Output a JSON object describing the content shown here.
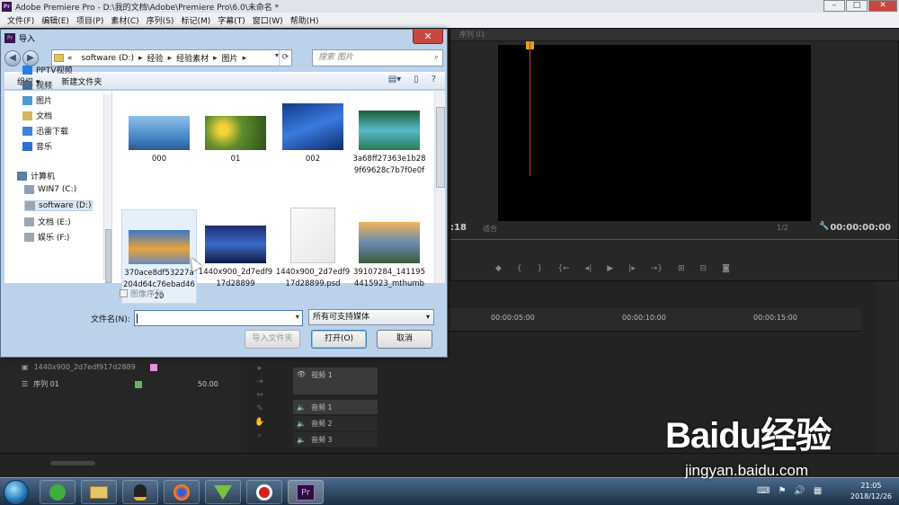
{
  "window": {
    "title": "Adobe Premiere Pro - D:\\我的文档\\Adobe\\Premiere Pro\\6.0\\未命名 *"
  },
  "menu": [
    "文件(F)",
    "编辑(E)",
    "项目(P)",
    "素材(C)",
    "序列(S)",
    "标记(M)",
    "字幕(T)",
    "窗口(W)",
    "帮助(H)"
  ],
  "monitor": {
    "tab": "序列 01",
    "left_timecode": ":18",
    "fit": "适合",
    "ratio": "1/2",
    "timecode": "00:00:00:00"
  },
  "timeline": {
    "ruler": [
      "00:00:05:00",
      "00:00:10:00",
      "00:00:15:00"
    ],
    "tracks": [
      "视频 1",
      "音频 1",
      "音频 2",
      "音频 3"
    ]
  },
  "project": {
    "items": [
      {
        "name": "1440x900_2d7edf917d2889",
        "color": "#e88fe0",
        "duration": ""
      },
      {
        "name": "序列 01",
        "color": "#5fb85f",
        "duration": "50.00"
      }
    ]
  },
  "dialog": {
    "title": "导入",
    "path": [
      "software (D:)",
      "经验",
      "经验素材",
      "图片"
    ],
    "search_placeholder": "搜索 图片",
    "organize": "组织 ▾",
    "new_folder": "新建文件夹",
    "nav": [
      {
        "label": "PPTV视频",
        "icon": "pptv-icon",
        "color": "#2a7de1"
      },
      {
        "label": "视频",
        "icon": "video-library-icon",
        "color": "#4a6a9a"
      },
      {
        "label": "图片",
        "icon": "pictures-library-icon",
        "color": "#4a9ad6"
      },
      {
        "label": "文档",
        "icon": "documents-library-icon",
        "color": "#d8b65a"
      },
      {
        "label": "迅雷下载",
        "icon": "thunder-download-icon",
        "color": "#3d86d6"
      },
      {
        "label": "音乐",
        "icon": "music-library-icon",
        "color": "#2f6fd0"
      },
      {
        "label": "计算机",
        "icon": "computer-icon",
        "color": "#5a7fa8"
      },
      {
        "label": "WIN7 (C:)",
        "icon": "drive-c-icon",
        "color": "#8aa0b8"
      },
      {
        "label": "software (D:)",
        "icon": "drive-d-icon",
        "color": "#9aa6b2"
      },
      {
        "label": "文档 (E:)",
        "icon": "drive-e-icon",
        "color": "#9aa6b2"
      },
      {
        "label": "娱乐 (F:)",
        "icon": "drive-f-icon",
        "color": "#9aa6b2"
      }
    ],
    "files": [
      {
        "name": "000",
        "kind": "woman"
      },
      {
        "name": "01",
        "kind": "flowers"
      },
      {
        "name": "002",
        "kind": "fish"
      },
      {
        "name": "3a68ff27363e1b289f69628c7b7f0e0f",
        "kind": "river"
      },
      {
        "name": "370ace8df53227a204d64c76ebad4620",
        "kind": "autumn"
      },
      {
        "name": "1440x900_2d7edf917d28899",
        "kind": "lake"
      },
      {
        "name": "1440x900_2d7edf917d28899.psd",
        "kind": "doc"
      },
      {
        "name": "39107284_1411954415923_mthumb",
        "kind": "sunset"
      }
    ],
    "image_sequence": "图像序列",
    "filename_label": "文件名(N):",
    "filename_value": "",
    "filter": "所有可支持媒体",
    "import_folder": "导入文件夹",
    "open": "打开(O)",
    "cancel": "取消"
  },
  "taskbar": {
    "time": "21:05",
    "date": "2018/12/26"
  },
  "watermark": {
    "brand": "Baidu经验",
    "url": "jingyan.baidu.com"
  }
}
